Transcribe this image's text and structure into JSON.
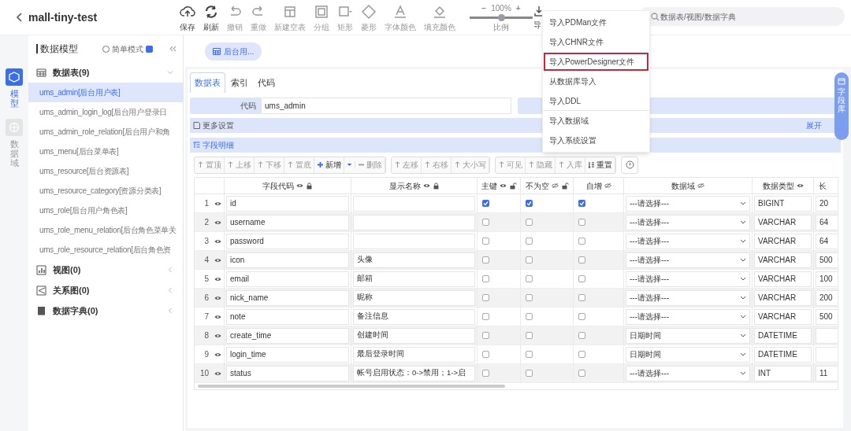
{
  "header": {
    "title": "mall-tiny-test"
  },
  "toolbar": [
    {
      "kind": "save",
      "label": "保存"
    },
    {
      "kind": "refresh",
      "label": "刷新"
    },
    {
      "kind": "undo",
      "label": "撤销"
    },
    {
      "kind": "redo",
      "label": "重做"
    },
    {
      "kind": "newtable",
      "label": "新建空表"
    },
    {
      "kind": "group",
      "label": "分组"
    },
    {
      "kind": "rect",
      "label": "矩形"
    },
    {
      "kind": "diamond",
      "label": "菱形"
    },
    {
      "kind": "fontcolor",
      "label": "字体颜色"
    },
    {
      "kind": "fillcolor",
      "label": "填充颜色"
    }
  ],
  "zoom": {
    "value": "100%",
    "label": "比例",
    "level": 0.5,
    "minus": "−",
    "plus": "+"
  },
  "import_button": {
    "label": "导"
  },
  "search": {
    "placeholder": "数据表/视图/数据字典"
  },
  "import_menu": [
    {
      "label": "导入PDMan文件",
      "selected": false,
      "divider": false
    },
    {
      "label": "导入CHNR文件",
      "selected": false,
      "divider": false
    },
    {
      "label": "导入PowerDesigner文件",
      "selected": true,
      "divider": false
    },
    {
      "label": "从数据库导入",
      "selected": false,
      "divider": false
    },
    {
      "label": "导入DDL",
      "selected": false,
      "divider": true
    },
    {
      "label": "导入数据域",
      "selected": false,
      "divider": false
    },
    {
      "label": "导入系统设置",
      "selected": false,
      "divider": false
    }
  ],
  "rail": [
    {
      "kind": "model",
      "label": "模型",
      "selected": true
    },
    {
      "kind": "domain",
      "label": "数据域",
      "selected": false
    }
  ],
  "sidebar": {
    "title": "数据模型",
    "simple_mode": {
      "label": "简单模式",
      "checked": true
    },
    "sections": [
      {
        "kind": "table",
        "label": "数据表(9)",
        "expanded": true,
        "children": [
          {
            "label": "ums_admin[后台用户表]",
            "selected": true
          },
          {
            "label": "ums_admin_login_log[后台用户登录日",
            "selected": false
          },
          {
            "label": "ums_admin_role_relation[后台用户和角",
            "selected": false
          },
          {
            "label": "ums_menu[后台菜单表]",
            "selected": false
          },
          {
            "label": "ums_resource[后台资源表]",
            "selected": false
          },
          {
            "label": "ums_resource_category[资源分类表]",
            "selected": false
          },
          {
            "label": "ums_role[后台用户角色表]",
            "selected": false
          },
          {
            "label": "ums_role_menu_relation[后台角色菜单关",
            "selected": false
          },
          {
            "label": "ums_role_resource_relation[后台角色资",
            "selected": false
          }
        ]
      },
      {
        "kind": "view",
        "label": "视图(0)",
        "expanded": false
      },
      {
        "kind": "diagram",
        "label": "关系图(0)",
        "expanded": false
      },
      {
        "kind": "dict",
        "label": "数据字典(0)",
        "expanded": false
      }
    ]
  },
  "open_tab": {
    "label": "后台用..."
  },
  "tabs": [
    {
      "label": "数据表",
      "selected": true
    },
    {
      "label": "索引",
      "selected": false
    },
    {
      "label": "代码",
      "selected": false
    }
  ],
  "code_field": {
    "label": "代码",
    "value": "ums_admin"
  },
  "more_settings": {
    "label": "更多设置",
    "toggle": "展开"
  },
  "fields_section": {
    "label": "字段明细"
  },
  "side_tab": {
    "label": "字段库"
  },
  "field_tools": [
    {
      "label": "置顶",
      "kind": "top",
      "disabled": true,
      "group_start": true
    },
    {
      "label": "上移",
      "kind": "up",
      "disabled": true,
      "group_start": false
    },
    {
      "label": "下移",
      "kind": "down",
      "disabled": true,
      "group_start": false
    },
    {
      "label": "置底",
      "kind": "bottom",
      "disabled": true,
      "group_start": false
    },
    {
      "label": "新增",
      "kind": "add",
      "disabled": false,
      "group_start": false
    },
    {
      "label": "删除",
      "kind": "delete",
      "disabled": true,
      "group_start": false
    },
    {
      "label": "左移",
      "kind": "left",
      "disabled": true,
      "group_start": true
    },
    {
      "label": "右移",
      "kind": "right",
      "disabled": true,
      "group_start": false
    },
    {
      "label": "大小写",
      "kind": "case",
      "disabled": true,
      "group_start": false
    },
    {
      "label": "可见",
      "kind": "show",
      "disabled": true,
      "group_start": true
    },
    {
      "label": "隐藏",
      "kind": "hide",
      "disabled": true,
      "group_start": false
    },
    {
      "label": "入库",
      "kind": "store",
      "disabled": true,
      "group_start": false
    },
    {
      "label": "重置",
      "kind": "reset",
      "disabled": false,
      "group_start": false
    }
  ],
  "table": {
    "columns": [
      {
        "label": "字段代码",
        "kind": "eye-lock"
      },
      {
        "label": "显示名称",
        "kind": "eye-lock"
      },
      {
        "label": "主键",
        "kind": "eye-unlock"
      },
      {
        "label": "不为空",
        "kind": "hidden-unlock"
      },
      {
        "label": "自增",
        "kind": "hidden"
      },
      {
        "label": "数据域",
        "kind": "hidden"
      },
      {
        "label": "数据类型",
        "kind": "eye"
      },
      {
        "label": "长",
        "kind": "none"
      }
    ],
    "rows": [
      {
        "index": "1",
        "code": "id",
        "pk": true,
        "not_null": true,
        "auto_inc": true,
        "domain": "---请选择---",
        "type": "BIGINT",
        "length": "20"
      },
      {
        "index": "2",
        "code": "username",
        "pk": false,
        "not_null": false,
        "auto_inc": false,
        "domain": "---请选择---",
        "type": "VARCHAR",
        "length": "64"
      },
      {
        "index": "3",
        "code": "password",
        "pk": false,
        "not_null": false,
        "auto_inc": false,
        "domain": "---请选择---",
        "type": "VARCHAR",
        "length": "64"
      },
      {
        "index": "4",
        "code": "icon",
        "name": "头像",
        "pk": false,
        "not_null": false,
        "auto_inc": false,
        "domain": "---请选择---",
        "type": "VARCHAR",
        "length": "500"
      },
      {
        "index": "5",
        "code": "email",
        "name": "邮箱",
        "pk": false,
        "not_null": false,
        "auto_inc": false,
        "domain": "---请选择---",
        "type": "VARCHAR",
        "length": "100"
      },
      {
        "index": "6",
        "code": "nick_name",
        "name": "昵称",
        "pk": false,
        "not_null": false,
        "auto_inc": false,
        "domain": "---请选择---",
        "type": "VARCHAR",
        "length": "200"
      },
      {
        "index": "7",
        "code": "note",
        "name": "备注信息",
        "pk": false,
        "not_null": false,
        "auto_inc": false,
        "domain": "---请选择---",
        "type": "VARCHAR",
        "length": "500"
      },
      {
        "index": "8",
        "code": "create_time",
        "name": "创建时间",
        "pk": false,
        "not_null": false,
        "auto_inc": false,
        "domain": "日期时间",
        "type": "DATETIME"
      },
      {
        "index": "9",
        "code": "login_time",
        "name": "最后登录时间",
        "pk": false,
        "not_null": false,
        "auto_inc": false,
        "domain": "日期时间",
        "type": "DATETIME"
      },
      {
        "index": "10",
        "code": "status",
        "name": "帐号启用状态：0->禁用；1->启",
        "pk": false,
        "not_null": false,
        "auto_inc": false,
        "domain": "---请选择---",
        "type": "INT",
        "length": "11"
      }
    ]
  }
}
